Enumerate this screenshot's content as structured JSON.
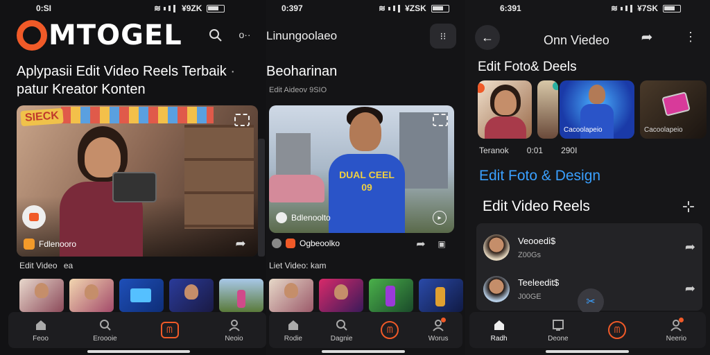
{
  "status": {
    "s1_time": "0:SI",
    "s1_batt": "¥9ZK",
    "s2_time": "0:397",
    "s2_batt": "¥ZSK",
    "s3_time": "6:391",
    "s3_batt": "¥7SK"
  },
  "screen1": {
    "logo_o": "O",
    "logo_rest": "MTOGEL",
    "headline_1": "Aplypasii Edit Video Reels Terbaik",
    "headline_2": "patur Kreator Konten",
    "card_sign": "SIECK",
    "card_user": "Fdlenooro",
    "section_label": "Edit Video",
    "section_extra": "ea",
    "nav": [
      "Feoo",
      "Eroooie",
      "",
      "Neoio"
    ]
  },
  "screen2": {
    "title": "Linungoolaeo",
    "headline": "Beoharinan",
    "sub": "Edit Aideov 9SIO",
    "card_user": "Bdlenoolto",
    "footer_user": "Ogbeoolko",
    "section_label": "Liet Video: kam",
    "jersey_text": "DUAL CEEL",
    "jersey_num": "09",
    "nav": [
      "Rodie",
      "Dagnie",
      "",
      "Worus"
    ]
  },
  "screen3": {
    "title": "Onn Viedeo",
    "section1": "Edit Foto& Deels",
    "card_caption": "Cacoolapeio",
    "stats": [
      "Teranok",
      "0:01",
      "290I"
    ],
    "design_title": "Edit Foto & Design",
    "reels_title": "Edit Video Reels",
    "list": [
      {
        "name": "Veooedi$",
        "sub": "Z00Gs"
      },
      {
        "name": "Teeleedit$",
        "sub": "J00GE"
      }
    ],
    "nav": [
      "Radh",
      "Deone",
      "",
      "Neerio"
    ]
  },
  "colors": {
    "accent_orange": "#f05a28",
    "accent_blue": "#3aa0ff",
    "nav_bg": "#1d1d20"
  }
}
